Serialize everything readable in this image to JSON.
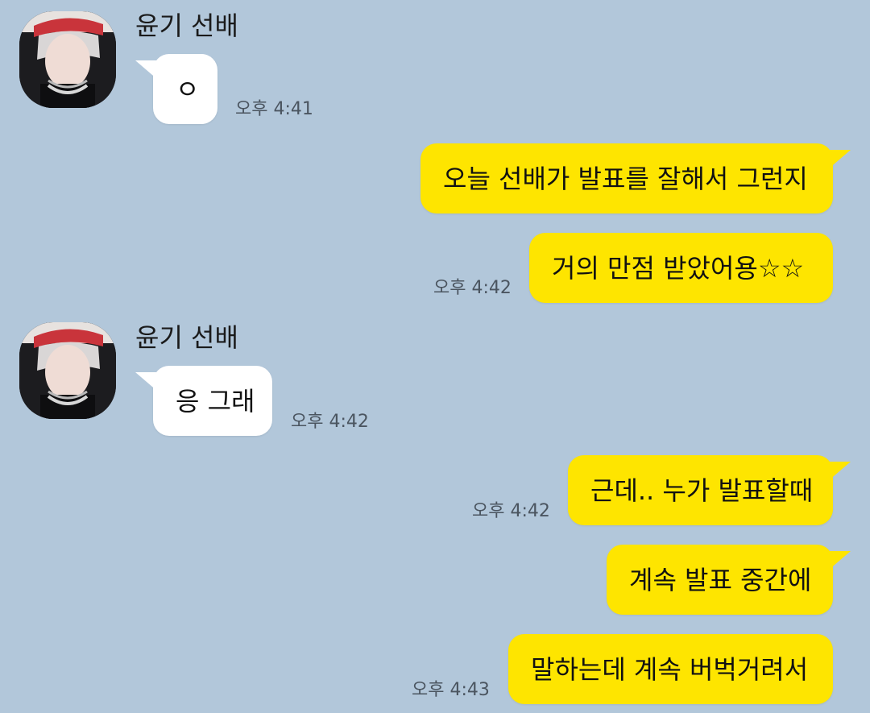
{
  "chat": {
    "sender_name": "윤기 선배",
    "colors": {
      "background": "#b2c7da",
      "incoming_bubble": "#ffffff",
      "outgoing_bubble": "#fee500"
    },
    "messages": [
      {
        "text": "ㅇ",
        "time": "오후 4:41"
      },
      {
        "text": "오늘 선배가 발표를 잘해서 그런지"
      },
      {
        "text": "거의 만점 받았어용☆☆",
        "time": "오후 4:42"
      },
      {
        "text": "응 그래",
        "time": "오후 4:42"
      },
      {
        "text": "근데.. 누가 발표할때",
        "time": "오후 4:42"
      },
      {
        "text": "계속 발표 중간에"
      },
      {
        "text": "말하는데 계속 버벅거려서",
        "time": "오후 4:43"
      }
    ]
  }
}
